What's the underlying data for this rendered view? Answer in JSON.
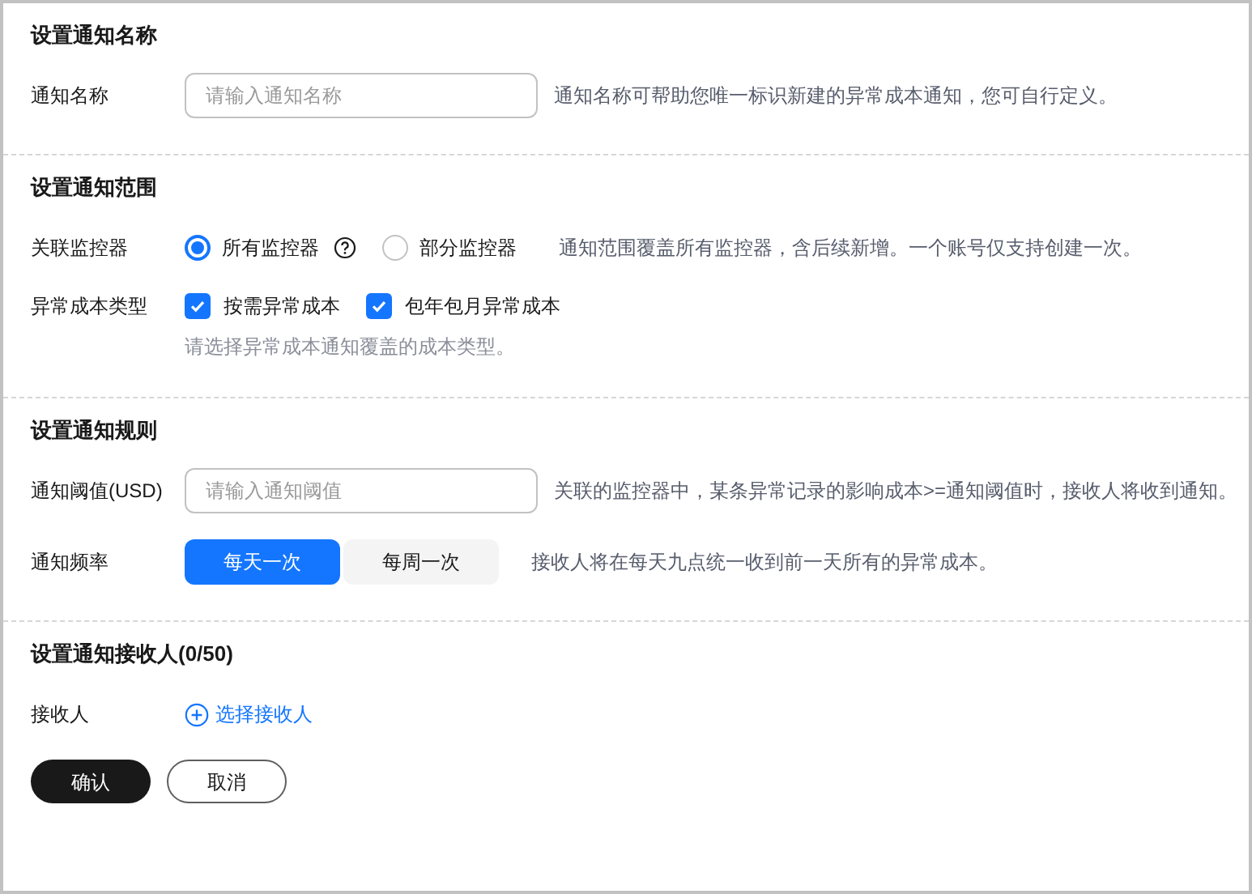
{
  "sections": [
    {
      "title": "设置通知名称",
      "rows": [
        {
          "kind": "input",
          "label": "通知名称",
          "placeholder": "请输入通知名称",
          "hint": "通知名称可帮助您唯一标识新建的异常成本通知，您可自行定义。"
        }
      ]
    },
    {
      "title": "设置通知范围",
      "rows": [
        {
          "kind": "radio",
          "label": "关联监控器",
          "options": [
            {
              "label": "所有监控器",
              "selected": true,
              "help": true
            },
            {
              "label": "部分监控器",
              "selected": false,
              "help": false
            }
          ],
          "hint": "通知范围覆盖所有监控器，含后续新增。一个账号仅支持创建一次。"
        },
        {
          "kind": "checkbox",
          "label": "异常成本类型",
          "options": [
            {
              "label": "按需异常成本",
              "checked": true
            },
            {
              "label": "包年包月异常成本",
              "checked": true
            }
          ],
          "note": "请选择异常成本通知覆盖的成本类型。"
        }
      ]
    },
    {
      "title": "设置通知规则",
      "rows": [
        {
          "kind": "input",
          "label": "通知阈值(USD)",
          "placeholder": "请输入通知阈值",
          "hint": "关联的监控器中，某条异常记录的影响成本>=通知阈值时，接收人将收到通知。"
        },
        {
          "kind": "segmented",
          "label": "通知频率",
          "options": [
            {
              "label": "每天一次",
              "selected": true
            },
            {
              "label": "每周一次",
              "selected": false
            }
          ],
          "hint": "接收人将在每天九点统一收到前一天所有的异常成本。"
        }
      ]
    },
    {
      "title": "设置通知接收人(0/50)",
      "rows": [
        {
          "kind": "link",
          "label": "接收人",
          "text": "选择接收人"
        }
      ]
    }
  ],
  "buttons": [
    {
      "label": "确认",
      "kind": "primary"
    },
    {
      "label": "取消",
      "kind": "secondary"
    }
  ]
}
